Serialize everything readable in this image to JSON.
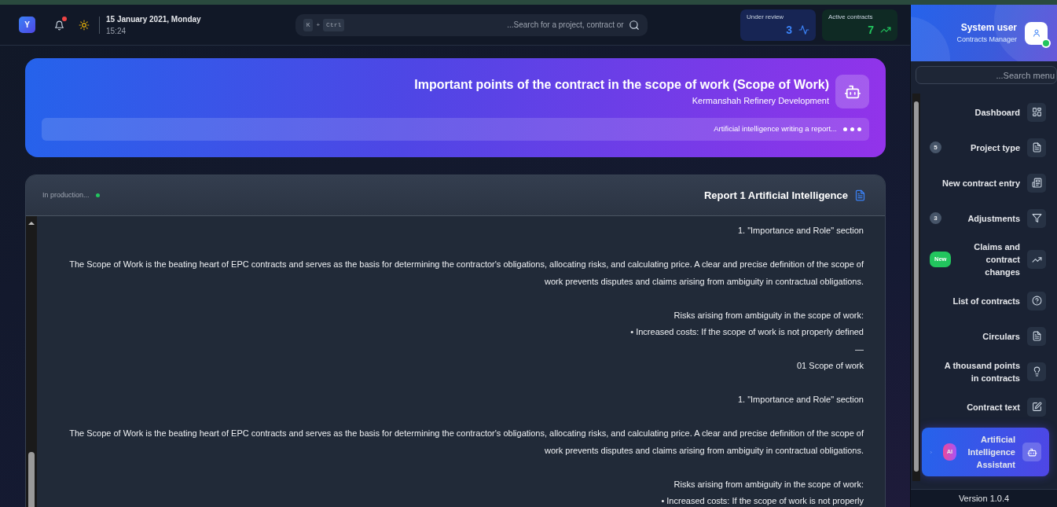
{
  "header": {
    "logo": "Y",
    "notifications": {
      "unread": true
    },
    "date": "15 January 2021, Monday",
    "time": "15:24",
    "search": {
      "placeholder": "...Search for a project, contract or",
      "keys": [
        "K",
        "+",
        "Ctrl"
      ]
    },
    "stats": [
      {
        "label": "Under review",
        "value": "3",
        "color": "#3b82f6"
      },
      {
        "label": "Active contracts",
        "value": "7",
        "color": "#22c55e"
      }
    ]
  },
  "banner": {
    "title": "Important points of the contract in the scope of work (Scope of Work)",
    "subtitle": "Kermanshah Refinery Development",
    "progress_text": "Artificial intelligence writing a report..."
  },
  "report": {
    "title": "Report 1 Artificial Intelligence",
    "status": "In production...",
    "blocks": [
      [
        "1. \"Importance and Role\" section"
      ],
      [
        "The Scope of Work is the beating heart of EPC contracts and serves as the basis for determining the contractor's obligations, allocating risks, and calculating price. A clear and precise definition of the scope of work prevents disputes and claims arising from ambiguity in contractual obligations."
      ],
      [
        "Risks arising from ambiguity in the scope of work:",
        "• Increased costs: If the scope of work is not properly defined",
        "—",
        "01 Scope of work"
      ],
      [
        "1. \"Importance and Role\" section"
      ],
      [
        "The Scope of Work is the beating heart of EPC contracts and serves as the basis for determining the contractor's obligations, allocating risks, and calculating price. A clear and precise definition of the scope of work prevents disputes and claims arising from ambiguity in contractual obligations."
      ],
      [
        "Risks arising from ambiguity in the scope of work:",
        "• Increased costs: If the scope of work is not properly"
      ]
    ]
  },
  "sidebar": {
    "user": {
      "name": "System user",
      "role": "Contracts Manager",
      "online": true
    },
    "search": {
      "placeholder": "...Search menu"
    },
    "items": [
      {
        "label": "Dashboard",
        "selected": false
      },
      {
        "label": "Project type",
        "selected": false,
        "badge": {
          "kind": "count",
          "text": "5"
        }
      },
      {
        "label": "New contract entry",
        "selected": false
      },
      {
        "label": "Adjustments",
        "selected": false,
        "badge": {
          "kind": "count",
          "text": "3"
        }
      },
      {
        "label": "Claims and contract changes",
        "selected": false,
        "badge": {
          "kind": "tag",
          "text": "New"
        }
      },
      {
        "label": "List of contracts",
        "selected": false
      },
      {
        "label": "Circulars",
        "selected": false
      },
      {
        "label": "A thousand points in contracts",
        "selected": false
      },
      {
        "label": "Contract text",
        "selected": false
      },
      {
        "label": "Artificial Intelligence Assistant",
        "selected": true,
        "badge": {
          "kind": "ai",
          "text": "AI"
        }
      }
    ],
    "version": "Version 1.0.4"
  }
}
